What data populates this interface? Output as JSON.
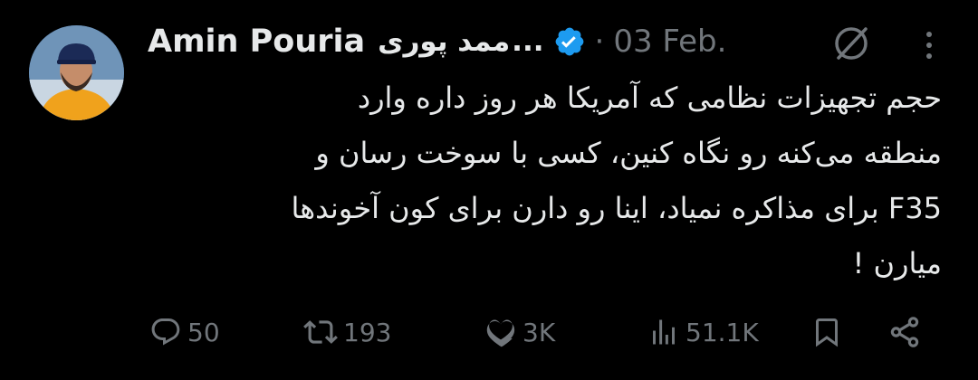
{
  "tweet": {
    "author_name": "Amin Pouria",
    "author_name_fa": "ممد پوری",
    "name_ellipsis": "...",
    "separator": "·",
    "date": "03 Feb.",
    "text_lines": [
      "حجم تجهیزات نظامی که آمریکا هر روز داره وارد",
      "منطقه می‌کنه رو نگاه کنین، کسی با سوخت رسان و",
      "F35 برای مذاکره نمیاد، اینا رو دارن برای کون آخوندها",
      "میارن !"
    ]
  },
  "actions": {
    "replies": "50",
    "retweets": "193",
    "likes": "3K",
    "views": "51.1K"
  },
  "colors": {
    "background": "#000000",
    "text": "#e7e9ea",
    "muted": "#71767b",
    "verified": "#1d9bf0"
  },
  "icons": [
    "avatar",
    "verified-badge-icon",
    "grok-icon",
    "more-icon",
    "reply-icon",
    "retweet-icon",
    "like-icon",
    "views-icon",
    "bookmark-icon",
    "share-icon"
  ]
}
